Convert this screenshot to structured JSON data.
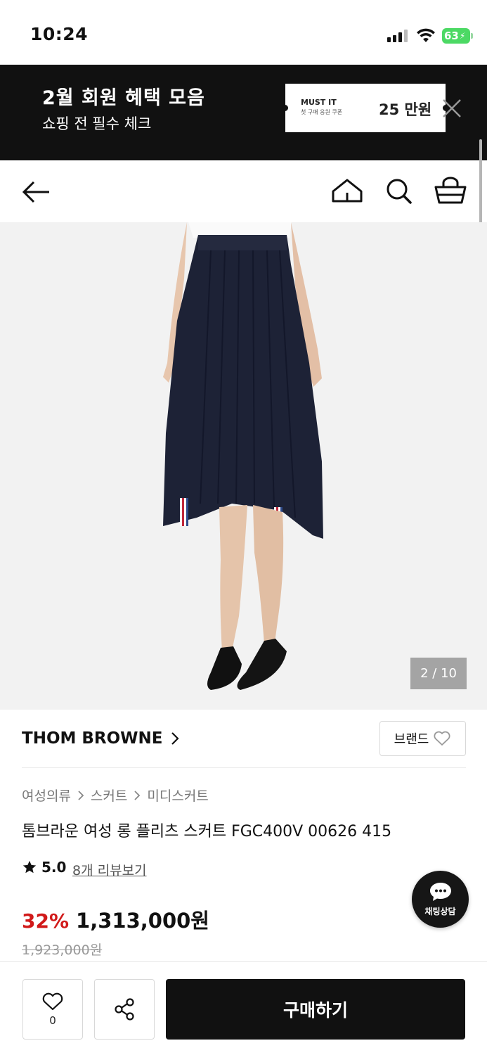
{
  "status_bar": {
    "time": "10:24",
    "battery": "63"
  },
  "promo": {
    "title": "2월 회원 혜택 모음",
    "subtitle": "쇼핑 전 필수 체크",
    "coupon_brand": "MUST IT",
    "coupon_desc": "첫 구매 응원 쿠폰",
    "coupon_amount": "25 만원"
  },
  "gallery": {
    "counter": "2 / 10",
    "current": 2,
    "total": 10
  },
  "product": {
    "brand": "THOM BROWNE",
    "brand_button": "브랜드",
    "breadcrumb": [
      "여성의류",
      "스커트",
      "미디스커트"
    ],
    "title": "톰브라운 여성 롱 플리츠 스커트 FGC400V 00626 415",
    "rating": "5.0",
    "review_link": "8개 리뷰보기",
    "discount": "32%",
    "price": "1,313,000원",
    "original_price": "1,923,000원"
  },
  "chat": {
    "label": "채팅상담"
  },
  "bottom_bar": {
    "like_count": "0",
    "buy_label": "구매하기"
  },
  "colors": {
    "promo_bg": "#111111",
    "discount": "#d11a1a",
    "buy_bg": "#111111",
    "battery": "#4cd964"
  }
}
